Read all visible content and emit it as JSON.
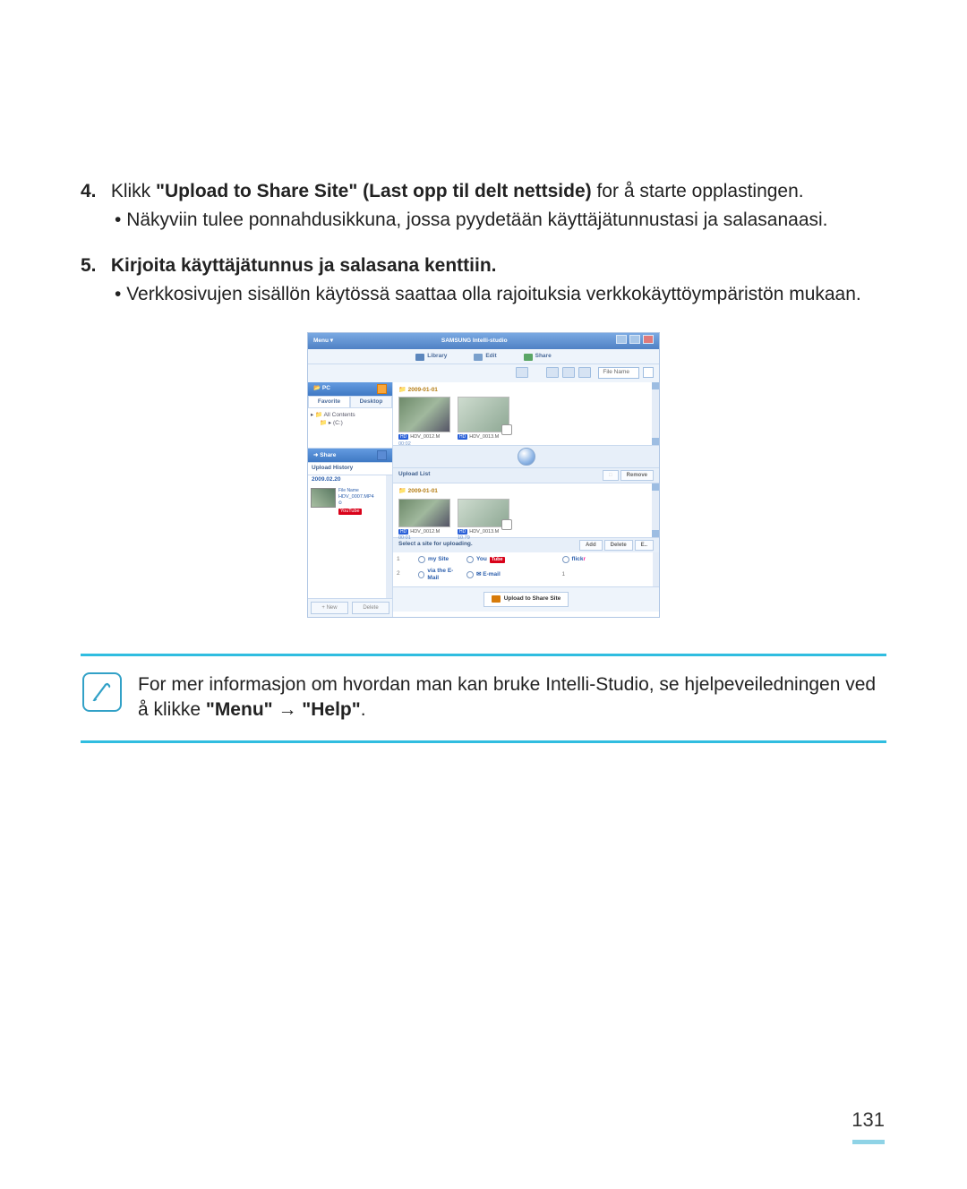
{
  "steps": {
    "s4": {
      "num": "4.",
      "prefix": "Klikk ",
      "bold": "\"Upload to Share Site\" (Last opp til delt nettside)",
      "suffix": " for å starte opplastingen.",
      "bullet": "Näkyviin tulee ponnahdusikkuna, jossa pyydetään käyttäjätunnustasi ja salasanaasi."
    },
    "s5": {
      "num": "5.",
      "bold": "Kirjoita käyttäjätunnus ja salasana kenttiin.",
      "bullet": "Verkkosivujen sisällön käytössä saattaa olla rajoituksia verkkokäyttöympäristön mukaan."
    }
  },
  "app": {
    "menu_label": "Menu ▾",
    "title_brand": "SAMSUNG Intelli-studio",
    "tabs": {
      "library": "Library",
      "edit": "Edit",
      "share": "Share"
    },
    "filename_label": "File Name",
    "sidebar": {
      "pc": "PC",
      "fav_tab": "Favorite",
      "desk_tab": "Desktop",
      "tree1": "▸ 📁 All Contents",
      "tree2": "📁 ▸ (C:)",
      "share": "Share",
      "upload_history": "Upload History",
      "date": "2009.02.20",
      "file_hdr": "File Name",
      "file_name": "HDV_0007.MP4",
      "youtube": "YouTube",
      "new_btn": "+ New",
      "del_btn": "Delete"
    },
    "gallery_folder": "2009-01-01",
    "thumbs": [
      {
        "name": "HDV_0012.M",
        "size": "00:02"
      },
      {
        "name": "HDV_0013.M",
        "size": ""
      }
    ],
    "upload_list_label": "Upload List",
    "remove_btn": "Remove",
    "ul_folder": "2009-01-01",
    "ul_thumbs": [
      {
        "name": "HDV_0012.M",
        "size": "00:01"
      },
      {
        "name": "HDV_0013.M",
        "size": "10.79"
      }
    ],
    "select_site": "Select a site for uploading.",
    "site_btns": {
      "add": "Add",
      "delete": "Delete",
      "e": "E.."
    },
    "sites": {
      "row1_num": "1",
      "row1_a": "my Site",
      "row1_b_pre": "You",
      "row1_b_badge": "Tube",
      "row1_c": "flick",
      "row1_c_r": "r",
      "row2_num": "2",
      "row2_a": "via the E-Mail",
      "row2_b": "✉ E-mail"
    },
    "upload_button": "Upload to Share Site"
  },
  "note": {
    "text_before": "For mer informasjon om hvordan man kan bruke Intelli-Studio, se hjelpeveiledningen ved å klikke ",
    "menu": "\"Menu\"",
    "arrow": " → ",
    "help": "\"Help\"",
    "period": "."
  },
  "page_number": "131"
}
